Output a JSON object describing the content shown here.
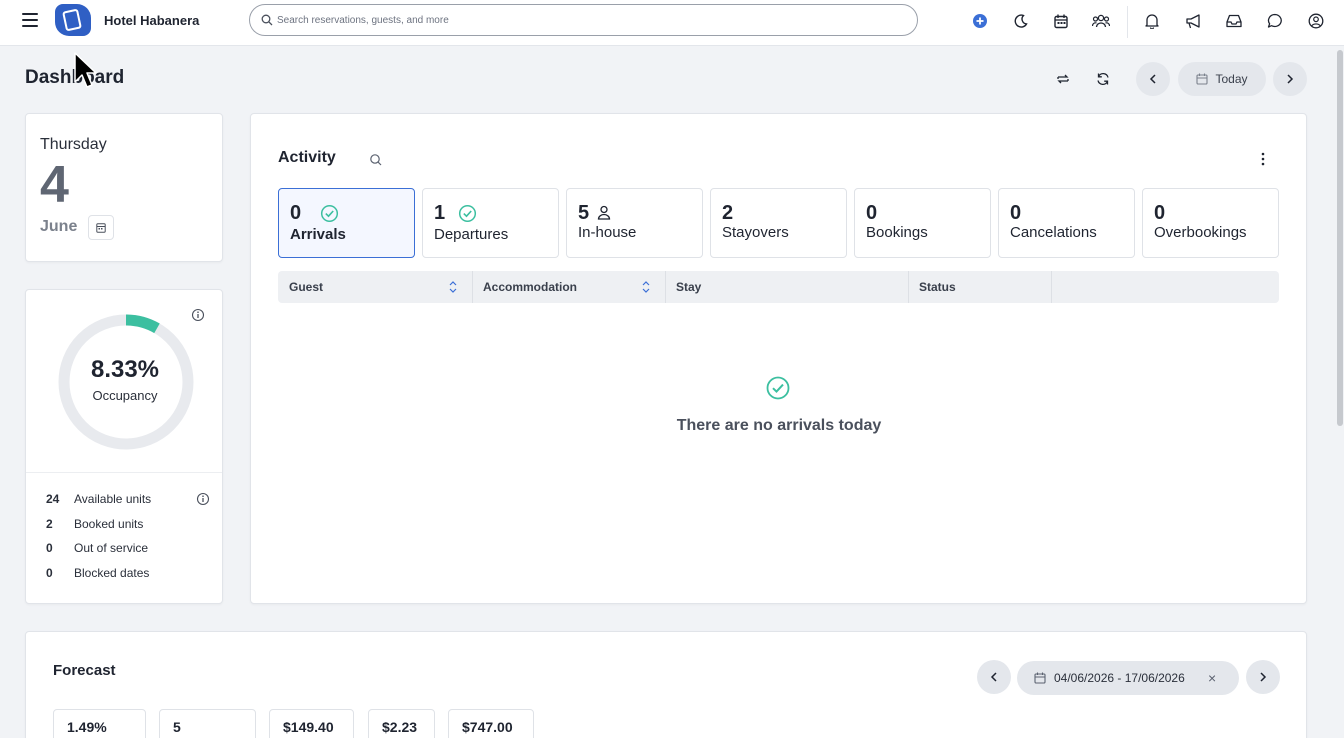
{
  "app": {
    "hotel_name": "Hotel Habanera"
  },
  "search": {
    "placeholder": "Search reservations, guests, and more"
  },
  "toolbar_icons": [
    "add-circle-icon",
    "moon-icon",
    "calendar-icon",
    "users-icon",
    "bell-icon",
    "megaphone-icon",
    "inbox-icon",
    "chat-icon",
    "account-icon"
  ],
  "header": {
    "title": "Dashboard",
    "today_label": "Today"
  },
  "date_card": {
    "weekday": "Thursday",
    "day": "4",
    "month": "June"
  },
  "occupancy": {
    "value": "8.33%",
    "label": "Occupancy",
    "fraction": 0.0833,
    "ring_color": "#3cbfa0",
    "stats": [
      {
        "num": "24",
        "label": "Available units"
      },
      {
        "num": "2",
        "label": "Booked units"
      },
      {
        "num": "0",
        "label": "Out of service"
      },
      {
        "num": "0",
        "label": "Blocked dates"
      }
    ]
  },
  "activity": {
    "title": "Activity",
    "tiles": [
      {
        "num": "0",
        "label": "Arrivals",
        "icon": "check-circle-icon"
      },
      {
        "num": "1",
        "label": "Departures",
        "icon": "check-circle-icon"
      },
      {
        "num": "5",
        "label": "In-house",
        "icon": "person-icon"
      },
      {
        "num": "2",
        "label": "Stayovers",
        "icon": ""
      },
      {
        "num": "0",
        "label": "Bookings",
        "icon": ""
      },
      {
        "num": "0",
        "label": "Cancelations",
        "icon": ""
      },
      {
        "num": "0",
        "label": "Overbookings",
        "icon": ""
      }
    ],
    "columns": [
      "Guest",
      "Accommodation",
      "Stay",
      "Status"
    ],
    "empty_message": "There are no arrivals today"
  },
  "forecast": {
    "title": "Forecast",
    "date_range": "04/06/2026 - 17/06/2026",
    "kpis": [
      "1.49%",
      "5",
      "$149.40",
      "$2.23",
      "$747.00"
    ]
  },
  "colors": {
    "accent": "#3b6fd6",
    "success": "#3cbfa0",
    "brand": "#2f5fc4"
  }
}
